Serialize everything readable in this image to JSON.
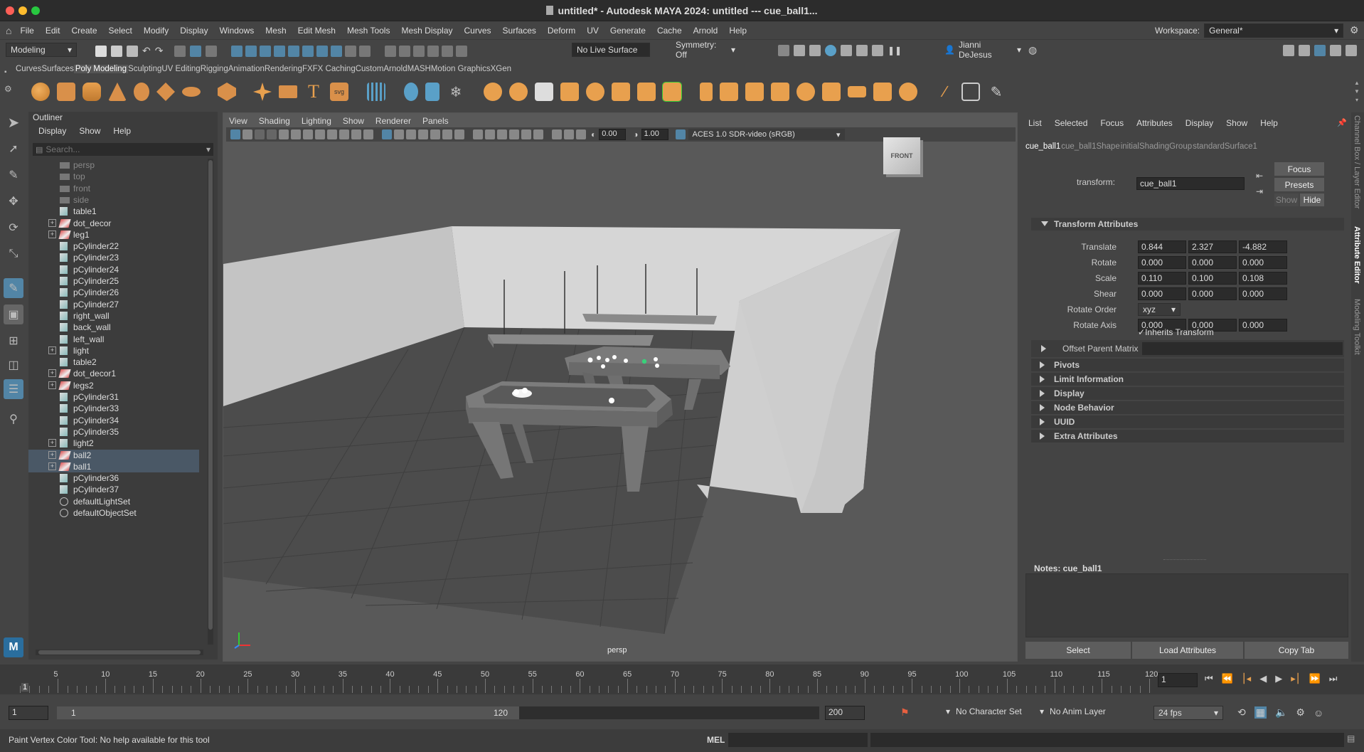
{
  "window": {
    "title": "untitled* - Autodesk MAYA 2024: untitled  ---  cue_ball1..."
  },
  "menu": [
    "File",
    "Edit",
    "Create",
    "Select",
    "Modify",
    "Display",
    "Windows",
    "Mesh",
    "Edit Mesh",
    "Mesh Tools",
    "Mesh Display",
    "Curves",
    "Surfaces",
    "Deform",
    "UV",
    "Generate",
    "Cache",
    "Arnold",
    "Help"
  ],
  "workspace": {
    "label": "Workspace:",
    "value": "General*"
  },
  "status": {
    "mode": "Modeling",
    "live_surface": "No Live Surface",
    "symmetry": "Symmetry: Off",
    "user": "Jianni DeJesus"
  },
  "shelf_tabs": [
    "Curves",
    "Surfaces",
    "Poly Modeling",
    "Sculpting",
    "UV Editing",
    "Rigging",
    "Animation",
    "Rendering",
    "FX",
    "FX Caching",
    "Custom",
    "Arnold",
    "MASH",
    "Motion Graphics",
    "XGen"
  ],
  "shelf_active": "Poly Modeling",
  "outliner": {
    "title": "Outliner",
    "menus": [
      "Display",
      "Show",
      "Help"
    ],
    "search_placeholder": "Search...",
    "items": [
      {
        "label": "persp",
        "dim": true,
        "type": "camera",
        "expand": false
      },
      {
        "label": "top",
        "dim": true,
        "type": "camera",
        "expand": false
      },
      {
        "label": "front",
        "dim": true,
        "type": "camera",
        "expand": false
      },
      {
        "label": "side",
        "dim": true,
        "type": "camera",
        "expand": false
      },
      {
        "label": "table1",
        "type": "mesh",
        "expand": false
      },
      {
        "label": "dot_decor",
        "type": "group",
        "expand": true
      },
      {
        "label": "leg1",
        "type": "group",
        "expand": true
      },
      {
        "label": "pCylinder22",
        "type": "mesh",
        "expand": false
      },
      {
        "label": "pCylinder23",
        "type": "mesh",
        "expand": false
      },
      {
        "label": "pCylinder24",
        "type": "mesh",
        "expand": false
      },
      {
        "label": "pCylinder25",
        "type": "mesh",
        "expand": false
      },
      {
        "label": "pCylinder26",
        "type": "mesh",
        "expand": false
      },
      {
        "label": "pCylinder27",
        "type": "mesh",
        "expand": false
      },
      {
        "label": "right_wall",
        "type": "mesh",
        "expand": false
      },
      {
        "label": "back_wall",
        "type": "mesh",
        "expand": false
      },
      {
        "label": "left_wall",
        "type": "mesh",
        "expand": false
      },
      {
        "label": "light",
        "type": "mesh",
        "expand": true
      },
      {
        "label": "table2",
        "type": "mesh",
        "expand": false
      },
      {
        "label": "dot_decor1",
        "type": "group",
        "expand": true
      },
      {
        "label": "legs2",
        "type": "group",
        "expand": true
      },
      {
        "label": "pCylinder31",
        "type": "mesh",
        "expand": false
      },
      {
        "label": "pCylinder33",
        "type": "mesh",
        "expand": false
      },
      {
        "label": "pCylinder34",
        "type": "mesh",
        "expand": false
      },
      {
        "label": "pCylinder35",
        "type": "mesh",
        "expand": false
      },
      {
        "label": "light2",
        "type": "mesh",
        "expand": true
      },
      {
        "label": "ball2",
        "type": "group",
        "expand": true,
        "selected": true
      },
      {
        "label": "ball1",
        "type": "group",
        "expand": true,
        "selected": true
      },
      {
        "label": "pCylinder36",
        "type": "mesh",
        "expand": false
      },
      {
        "label": "pCylinder37",
        "type": "mesh",
        "expand": false
      },
      {
        "label": "defaultLightSet",
        "type": "set",
        "expand": false
      },
      {
        "label": "defaultObjectSet",
        "type": "set",
        "expand": false
      }
    ]
  },
  "viewport": {
    "menus": [
      "View",
      "Shading",
      "Lighting",
      "Show",
      "Renderer",
      "Panels"
    ],
    "exposure": "0.00",
    "gamma": "1.00",
    "color_space": "ACES 1.0 SDR-video (sRGB)",
    "camera_label": "persp",
    "view_cube": "FRONT"
  },
  "attr": {
    "menus": [
      "List",
      "Selected",
      "Focus",
      "Attributes",
      "Display",
      "Show",
      "Help"
    ],
    "tabs": [
      "cue_ball1",
      "cue_ball1Shape",
      "initialShadingGroup",
      "standardSurface1"
    ],
    "transform_label": "transform:",
    "transform_value": "cue_ball1",
    "buttons": {
      "focus": "Focus",
      "presets": "Presets",
      "show": "Show",
      "hide": "Hide"
    },
    "section": "Transform Attributes",
    "translate": {
      "label": "Translate",
      "x": "0.844",
      "y": "2.327",
      "z": "-4.882"
    },
    "rotate": {
      "label": "Rotate",
      "x": "0.000",
      "y": "0.000",
      "z": "0.000"
    },
    "scale": {
      "label": "Scale",
      "x": "0.110",
      "y": "0.100",
      "z": "0.108"
    },
    "shear": {
      "label": "Shear",
      "x": "0.000",
      "y": "0.000",
      "z": "0.000"
    },
    "rotate_order": {
      "label": "Rotate Order",
      "value": "xyz"
    },
    "rotate_axis": {
      "label": "Rotate Axis",
      "x": "0.000",
      "y": "0.000",
      "z": "0.000"
    },
    "inherits": "Inherits Transform",
    "offset": "Offset Parent Matrix",
    "sections": [
      "Pivots",
      "Limit Information",
      "Display",
      "Node Behavior",
      "UUID",
      "Extra Attributes"
    ],
    "notes": "Notes:  cue_ball1",
    "bottom": {
      "select": "Select",
      "load": "Load Attributes",
      "copy": "Copy Tab"
    }
  },
  "side_tabs": [
    "Channel Box / Layer Editor",
    "Attribute Editor",
    "Modeling Toolkit"
  ],
  "timeline": {
    "ticks": [
      "5",
      "10",
      "15",
      "20",
      "25",
      "30",
      "35",
      "40",
      "45",
      "50",
      "55",
      "60",
      "65",
      "70",
      "75",
      "80",
      "85",
      "90",
      "95",
      "100",
      "105",
      "110",
      "115",
      "120"
    ],
    "start_marker": "1",
    "current": "1"
  },
  "range": {
    "start": "1",
    "inner_start": "1",
    "inner_end": "120",
    "end": "200",
    "character_set": "No Character Set",
    "anim_layer": "No Anim Layer",
    "fps": "24 fps"
  },
  "help": {
    "text": "Paint Vertex Color Tool: No help available for this tool",
    "mel": "MEL"
  },
  "colors": {
    "accent": "#5285a6",
    "orange": "#e8a04e",
    "bg": "#444444"
  }
}
